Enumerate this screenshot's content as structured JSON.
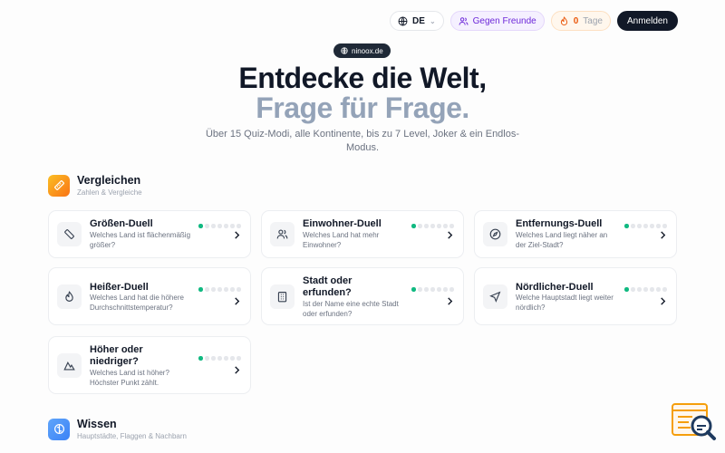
{
  "nav": {
    "lang": "DE",
    "friends": "Gegen Freunde",
    "streak_count": "0",
    "streak_unit": "Tage",
    "login": "Anmelden"
  },
  "hero": {
    "badge": "ninoox.de",
    "title_line1": "Entdecke die Welt,",
    "title_line2": "Frage für Frage.",
    "subtitle": "Über 15 Quiz-Modi, alle Kontinente, bis zu 7 Level, Joker & ein Endlos-Modus."
  },
  "sections": [
    {
      "title": "Vergleichen",
      "subtitle": "Zahlen & Vergleiche",
      "icon": "ruler-icon"
    },
    {
      "title": "Wissen",
      "subtitle": "Hauptstädte, Flaggen & Nachbarn",
      "icon": "brain-icon"
    }
  ],
  "level_progress": {
    "completed": 1,
    "total": 7
  },
  "cards": [
    {
      "title": "Größen-Duell",
      "desc": "Welches Land ist flächenmäßig größer?",
      "icon": "ruler-icon"
    },
    {
      "title": "Einwohner-Duell",
      "desc": "Welches Land hat mehr Einwohner?",
      "icon": "users-icon"
    },
    {
      "title": "Entfernungs-Duell",
      "desc": "Welches Land liegt näher an der Ziel-Stadt?",
      "icon": "compass-icon"
    },
    {
      "title": "Heißer-Duell",
      "desc": "Welches Land hat die höhere Durchschnittstemperatur?",
      "icon": "flame-icon"
    },
    {
      "title": "Stadt oder erfunden?",
      "desc": "Ist der Name eine echte Stadt oder erfunden?",
      "icon": "building-icon"
    },
    {
      "title": "Nördlicher-Duell",
      "desc": "Welche Hauptstadt liegt weiter nördlich?",
      "icon": "navigation-icon"
    },
    {
      "title": "Höher oder niedriger?",
      "desc": "Welches Land ist höher? Höchster Punkt zählt.",
      "icon": "mountain-icon"
    }
  ],
  "colors": {
    "accent_green": "#10b981",
    "orange": "#f97316",
    "blue": "#3b82f6"
  }
}
